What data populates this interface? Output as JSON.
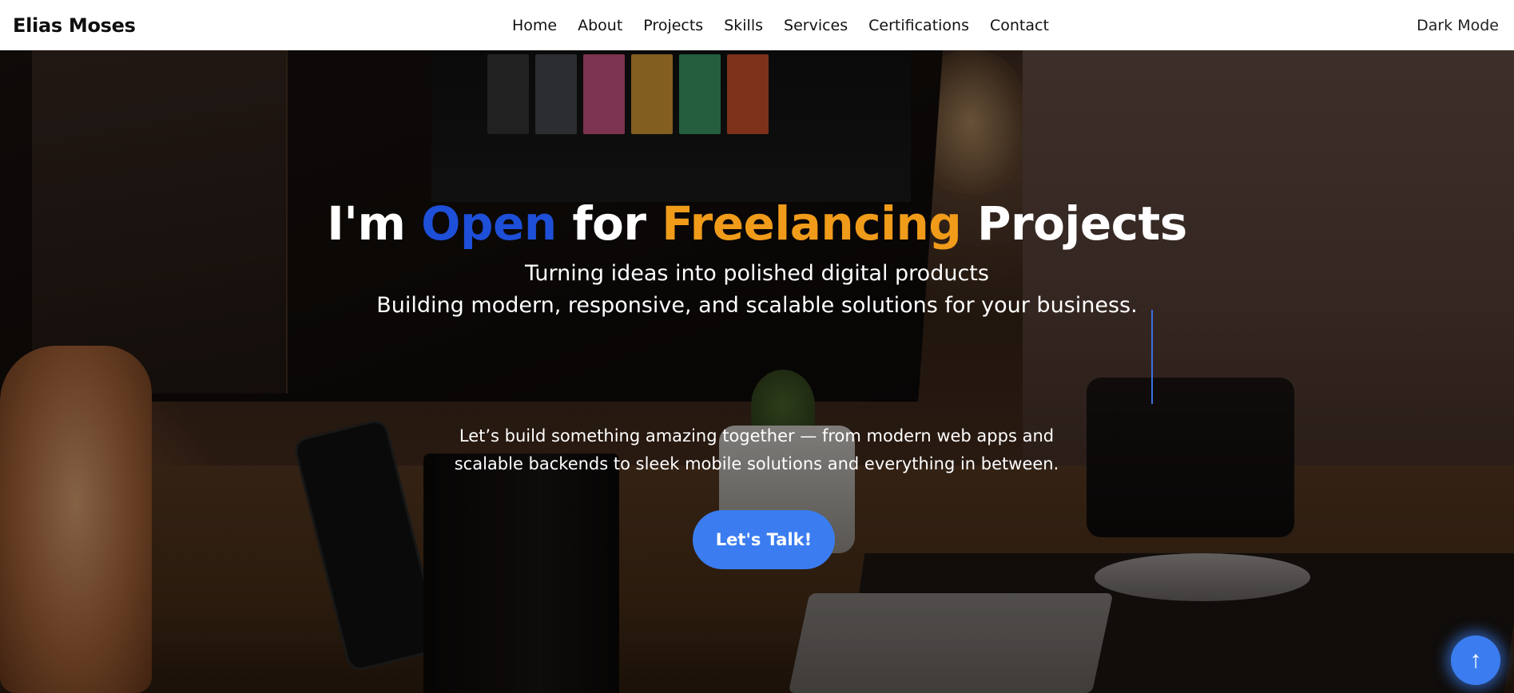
{
  "brand": {
    "name": "Elias Moses"
  },
  "nav": {
    "items": [
      {
        "label": "Home"
      },
      {
        "label": "About"
      },
      {
        "label": "Projects"
      },
      {
        "label": "Skills"
      },
      {
        "label": "Services"
      },
      {
        "label": "Certifications"
      },
      {
        "label": "Contact"
      }
    ],
    "dark_mode_label": "Dark Mode"
  },
  "hero": {
    "title": {
      "part1": "I'm ",
      "highlight1": "Open",
      "part2": " for ",
      "highlight2": "Freelancing",
      "part3": " Projects"
    },
    "subtitle_line1": "Turning ideas into polished digital products",
    "subtitle_line2": "Building modern, responsive, and scalable solutions for your business.",
    "description": "Let’s build something amazing together — from modern web apps and scalable backends to sleek mobile solutions and everything in between.",
    "cta_label": "Let's Talk!"
  },
  "scroll_top": {
    "icon": "arrow-up-icon",
    "glyph": "↑"
  },
  "colors": {
    "accent_blue": "#1e4fd8",
    "accent_orange": "#f09b1a",
    "button_blue": "#3b7df0"
  }
}
